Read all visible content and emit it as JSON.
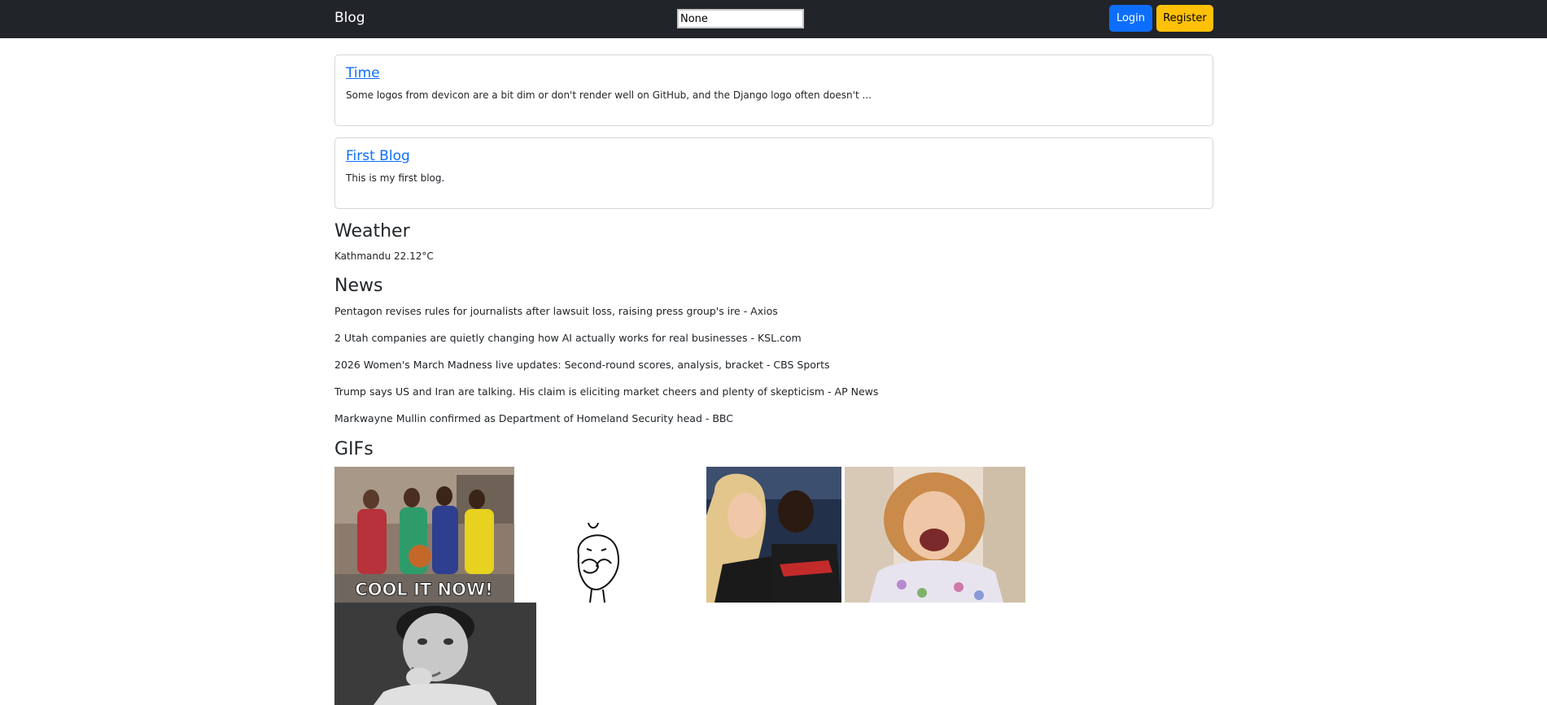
{
  "navbar": {
    "brand": "Blog",
    "location_value": "None",
    "login_label": "Login",
    "register_label": "Register"
  },
  "blogs": [
    {
      "title": "Time",
      "excerpt": "Some logos from devicon are a bit dim or don't render well on GitHub, and the Django logo often doesn't ..."
    },
    {
      "title": "First Blog",
      "excerpt": "This is my first blog."
    }
  ],
  "weather": {
    "heading": "Weather",
    "text": "Kathmandu 22.12°C"
  },
  "news": {
    "heading": "News",
    "items": [
      "Pentagon revises rules for journalists after lawsuit loss, raising press group's ire - Axios",
      "2 Utah companies are quietly changing how AI actually works for real businesses - KSL.com",
      "2026 Women's March Madness live updates: Second-round scores, analysis, bracket - CBS Sports",
      "Trump says US and Iran are talking. His claim is eliciting market cheers and plenty of skepticism - AP News",
      "Markwayne Mullin confirmed as Department of Homeland Security head - BBC"
    ]
  },
  "gifs": {
    "heading": "GIFs",
    "items": [
      {
        "name": "cool-it-now-gif",
        "caption": "COOL IT NOW!"
      },
      {
        "name": "cartoon-face-gif"
      },
      {
        "name": "basketball-hug-gif"
      },
      {
        "name": "laughing-woman-gif"
      },
      {
        "name": "thinking-boy-gif"
      }
    ]
  },
  "colors": {
    "navbar_bg": "#212529",
    "primary": "#0d6efd",
    "warning": "#ffc107"
  }
}
